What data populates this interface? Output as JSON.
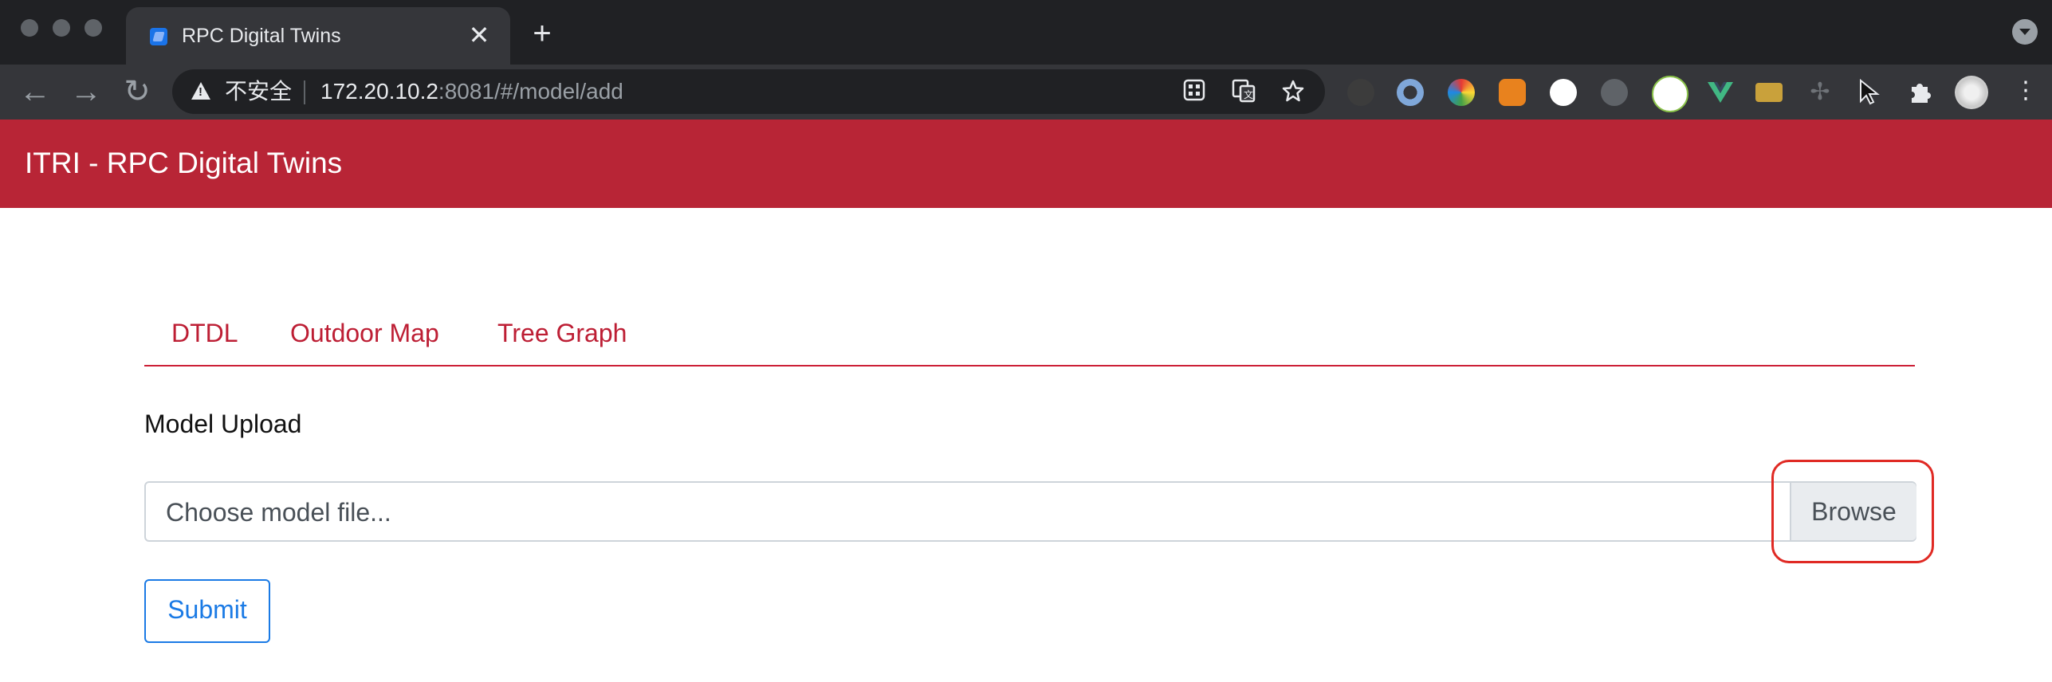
{
  "browser": {
    "tab_title": "RPC Digital Twins",
    "tab_close_glyph": "✕",
    "new_tab_glyph": "+",
    "security_label": "不安全",
    "url_host": "172.20.10.2",
    "url_path": ":8081/#/model/add",
    "nav": {
      "back_glyph": "←",
      "forward_glyph": "→",
      "reload_glyph": "↻"
    },
    "omnibox_icons": [
      "qr-code-icon",
      "translate-icon",
      "bookmark-star-icon"
    ],
    "extensions": [
      "extension-dark-icon",
      "extension-blue-circle-icon",
      "extension-color-wheel-icon",
      "metamask-fox-icon",
      "extension-json-icon",
      "extension-sync-icon",
      "extension-green-doc-icon",
      "vue-devtools-icon",
      "extension-image-icon",
      "extension-move-icon",
      "cursor-icon",
      "puzzle-extensions-icon",
      "profile-avatar-icon",
      "more-menu-icon"
    ]
  },
  "app": {
    "title": "ITRI - RPC Digital Twins",
    "tabs": [
      {
        "label": "DTDL"
      },
      {
        "label": "Outdoor Map"
      },
      {
        "label": "Tree Graph"
      }
    ],
    "upload": {
      "section_label": "Model Upload",
      "placeholder": "Choose model file...",
      "browse_label": "Browse",
      "submit_label": "Submit"
    }
  },
  "colors": {
    "header": "#b82536",
    "tab_text": "#bd1e34",
    "submit": "#1a7ae5",
    "highlight": "#e02a24"
  }
}
